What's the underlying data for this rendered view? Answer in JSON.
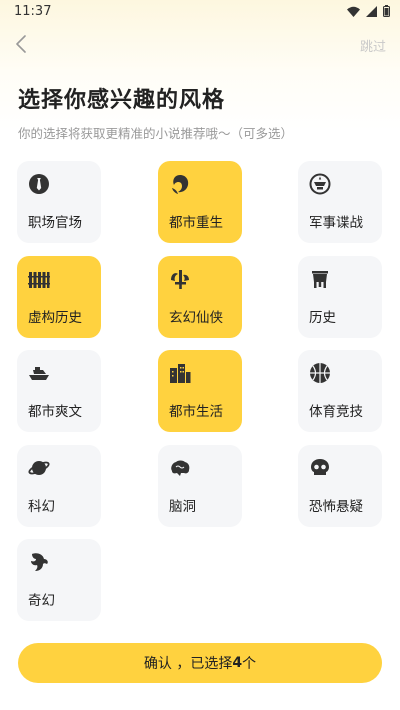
{
  "status_bar": {
    "time": "11:37"
  },
  "nav": {
    "skip_label": "跳过"
  },
  "page": {
    "title": "选择你感兴趣的风格",
    "subtitle": "你的选择将获取更精准的小说推荐哦～（可多选）"
  },
  "genres": [
    {
      "label": "职场官场",
      "icon": "tie-icon",
      "selected": false
    },
    {
      "label": "都市重生",
      "icon": "phoenix-icon",
      "selected": true
    },
    {
      "label": "军事谍战",
      "icon": "military-badge-icon",
      "selected": false
    },
    {
      "label": "虚构历史",
      "icon": "bamboo-scroll-icon",
      "selected": true
    },
    {
      "label": "玄幻仙侠",
      "icon": "sword-icon",
      "selected": true
    },
    {
      "label": "历史",
      "icon": "ancient-vessel-icon",
      "selected": false
    },
    {
      "label": "都市爽文",
      "icon": "yacht-icon",
      "selected": false
    },
    {
      "label": "都市生活",
      "icon": "city-buildings-icon",
      "selected": true
    },
    {
      "label": "体育竞技",
      "icon": "basketball-icon",
      "selected": false
    },
    {
      "label": "科幻",
      "icon": "planet-icon",
      "selected": false
    },
    {
      "label": "脑洞",
      "icon": "brain-icon",
      "selected": false
    },
    {
      "label": "恐怖悬疑",
      "icon": "skull-icon",
      "selected": false
    },
    {
      "label": "奇幻",
      "icon": "dragon-icon",
      "selected": false
    }
  ],
  "confirm": {
    "prefix": "确认 ，已选择",
    "count": "4",
    "suffix": "个"
  },
  "colors": {
    "accent": "#ffd23f",
    "card_bg": "#f5f6f8",
    "subtitle": "#9a9a9a"
  }
}
